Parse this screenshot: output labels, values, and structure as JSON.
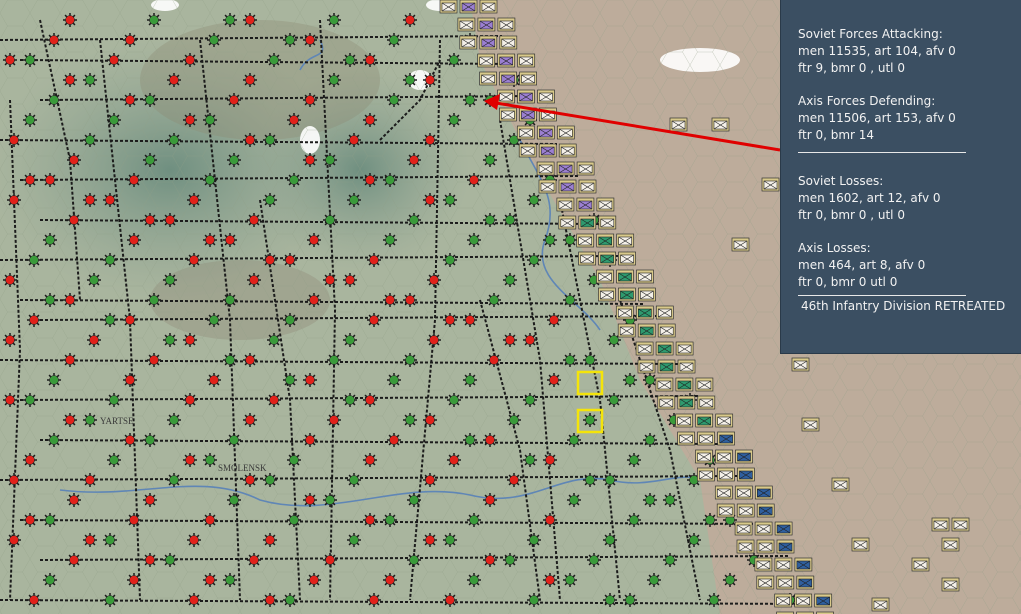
{
  "panel": {
    "attacker_title": "Soviet Forces Attacking:",
    "attacker_line1": "men  11535,  art  104,  afv  0",
    "attacker_line2": "ftr  9,  bmr  0 ,  utl  0",
    "defender_title": "Axis Forces Defending:",
    "defender_line1": "men  11506,  art  153,  afv  0",
    "defender_line2": "ftr  0,  bmr  14",
    "att_loss_title": "Soviet Losses:",
    "att_loss_line1": "men  1602,  art  12,  afv  0",
    "att_loss_line2": "ftr  0,  bmr  0 ,  utl  0",
    "def_loss_title": "Axis Losses:",
    "def_loss_line1": "men  464,  art  8,  afv  0",
    "def_loss_line2": " ftr  0,  bmr  0   utl  0",
    "result": "46th Infantry Division RETREATED"
  },
  "map_labels": {
    "smolensk": "SMOLENSK",
    "yartsevo": "YARTSE"
  },
  "colors": {
    "terrain": "#a9b59e",
    "forest": "#7e9a86",
    "marsh_east": "#c4a99a",
    "soviet_node": "#e0221b",
    "axis_node": "#3a9a3a",
    "rail": "#1b1b1b",
    "counter_bg": "#d8c98a",
    "highlight": "#f4e40a",
    "attack_arrow": "#e00000",
    "panel_bg": "#3b4f62"
  }
}
